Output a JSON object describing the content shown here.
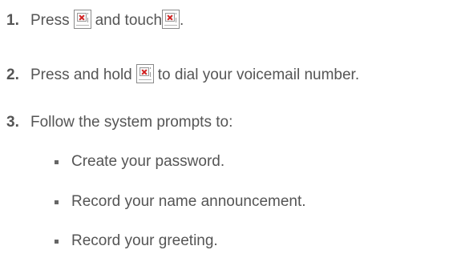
{
  "steps": [
    {
      "number": "1.",
      "text_a": "Press",
      "text_b": "and touch",
      "text_c": "."
    },
    {
      "number": "2.",
      "text_a": "Press and hold",
      "text_b": "to dial your voicemail number."
    },
    {
      "number": "3.",
      "text_a": "Follow the system prompts to:"
    }
  ],
  "sub_items": [
    "Create your password.",
    "Record your name announcement.",
    "Record your greeting."
  ],
  "icons": {
    "broken_image": "broken-image-icon"
  },
  "colors": {
    "text": "#555555",
    "icon_x": "#d21f1f"
  }
}
